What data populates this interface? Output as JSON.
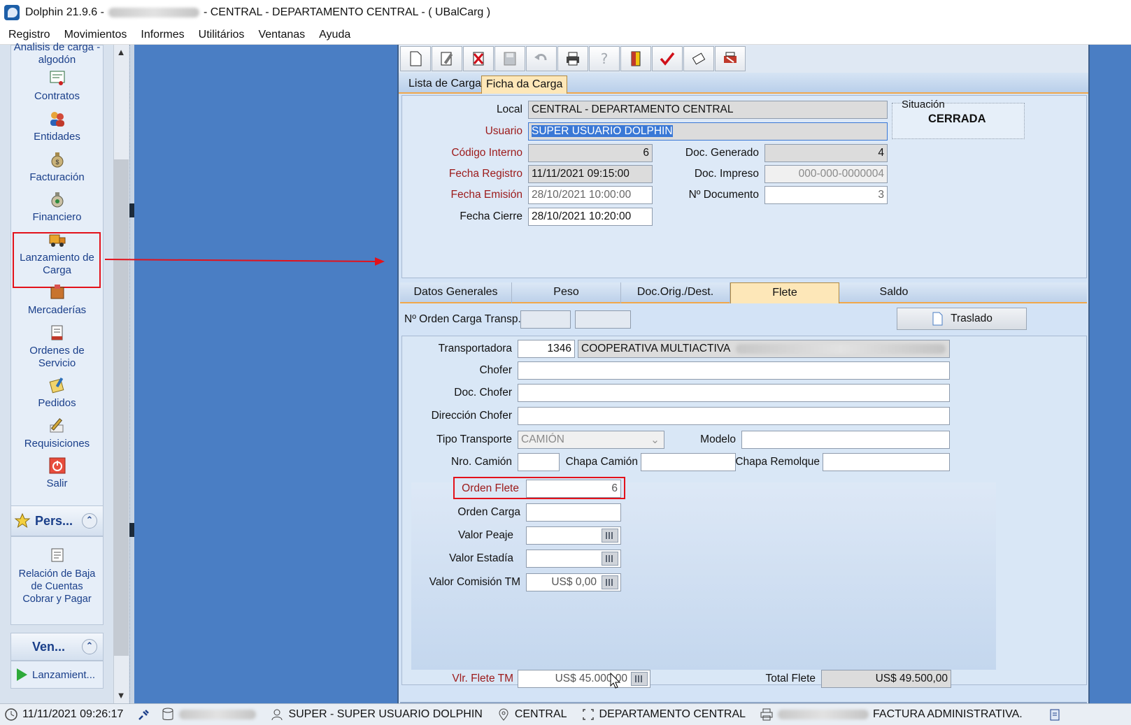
{
  "window": {
    "title_prefix": "Dolphin 21.9.6 -",
    "title_suffix": "- CENTRAL - DEPARTAMENTO CENTRAL -  ( UBalCarg )"
  },
  "menu": [
    "Registro",
    "Movimientos",
    "Informes",
    "Utilitários",
    "Ventanas",
    "Ayuda"
  ],
  "sidebar": {
    "items": [
      {
        "label": "Analisis de carga - algodón",
        "icon": "cotton-analysis-icon"
      },
      {
        "label": "Contratos",
        "icon": "contract-icon"
      },
      {
        "label": "Entidades",
        "icon": "people-icon"
      },
      {
        "label": "Facturación",
        "icon": "money-bag-icon"
      },
      {
        "label": "Financiero",
        "icon": "money-bag-icon"
      },
      {
        "label": "Lanzamiento de Carga",
        "icon": "truck-icon"
      },
      {
        "label": "Mercaderías",
        "icon": "box-icon"
      },
      {
        "label": "Ordenes de Servicio",
        "icon": "clipboard-icon"
      },
      {
        "label": "Pedidos",
        "icon": "notes-icon"
      },
      {
        "label": "Requisiciones",
        "icon": "pen-icon"
      },
      {
        "label": "Salir",
        "icon": "power-icon"
      }
    ],
    "pers_title": "Pers...",
    "pers_item": "Relación de Baja de Cuentas Cobrar y Pagar",
    "ven_title": "Ven...",
    "ven_item": "Lanzamient..."
  },
  "toptabs": [
    "Lista de Cargas",
    "Ficha da Carga"
  ],
  "header": {
    "local_label": "Local",
    "local_value": "CENTRAL - DEPARTAMENTO CENTRAL",
    "usuario_label": "Usuario",
    "usuario_value": "SUPER USUARIO DOLPHIN",
    "codigo_label": "Código Interno",
    "codigo_value": "6",
    "doc_generado_label": "Doc. Generado",
    "doc_generado_value": "4",
    "fecha_registro_label": "Fecha Registro",
    "fecha_registro_value": "11/11/2021 09:15:00",
    "doc_impreso_label": "Doc. Impreso",
    "doc_impreso_value": "000-000-0000004",
    "fecha_emision_label": "Fecha Emisión",
    "fecha_emision_value": "28/10/2021 10:00:00",
    "nro_documento_label": "Nº Documento",
    "nro_documento_value": "3",
    "fecha_cierre_label": "Fecha Cierre",
    "fecha_cierre_value": "28/10/2021 10:20:00",
    "situacion_label": "Situación",
    "situacion_value": "CERRADA"
  },
  "subtabs": [
    "Datos Generales",
    "Peso",
    "Doc.Orig./Dest.",
    "Flete",
    "Saldo"
  ],
  "flete": {
    "orden_carga_transp_label": "Nº Orden Carga Transp.",
    "traslado_button": "Traslado",
    "transportadora_label": "Transportadora",
    "transportadora_code": "1346",
    "transportadora_name": "COOPERATIVA MULTIACTIVA",
    "chofer_label": "Chofer",
    "doc_chofer_label": "Doc. Chofer",
    "direccion_chofer_label": "Dirección Chofer",
    "tipo_transporte_label": "Tipo Transporte",
    "tipo_transporte_value": "CAMIÓN",
    "modelo_label": "Modelo",
    "nro_camion_label": "Nro. Camión",
    "chapa_camion_label": "Chapa Camión",
    "chapa_remolque_label": "Chapa Remolque",
    "orden_flete_label": "Orden Flete",
    "orden_flete_value": "6",
    "orden_carga_label": "Orden Carga",
    "valor_peaje_label": "Valor Peaje",
    "valor_estadia_label": "Valor Estadía",
    "valor_comision_label": "Valor Comisión TM",
    "valor_comision_value": "US$ 0,00",
    "vlr_flete_label": "Vlr. Flete TM",
    "vlr_flete_value": "US$ 45.000,00",
    "total_flete_label": "Total Flete",
    "total_flete_value": "US$ 49.500,00"
  },
  "status": {
    "datetime": "11/11/2021 09:26:17",
    "user": "SUPER - SUPER USUARIO DOLPHIN",
    "location": "CENTRAL",
    "department": "DEPARTAMENTO CENTRAL",
    "document": "FACTURA ADMINISTRATIVA."
  },
  "colors": {
    "desktop": "#4a7ec4",
    "accent_red": "#e3121b",
    "required_label": "#9c1a1a",
    "active_tab": "#fde7b8"
  }
}
